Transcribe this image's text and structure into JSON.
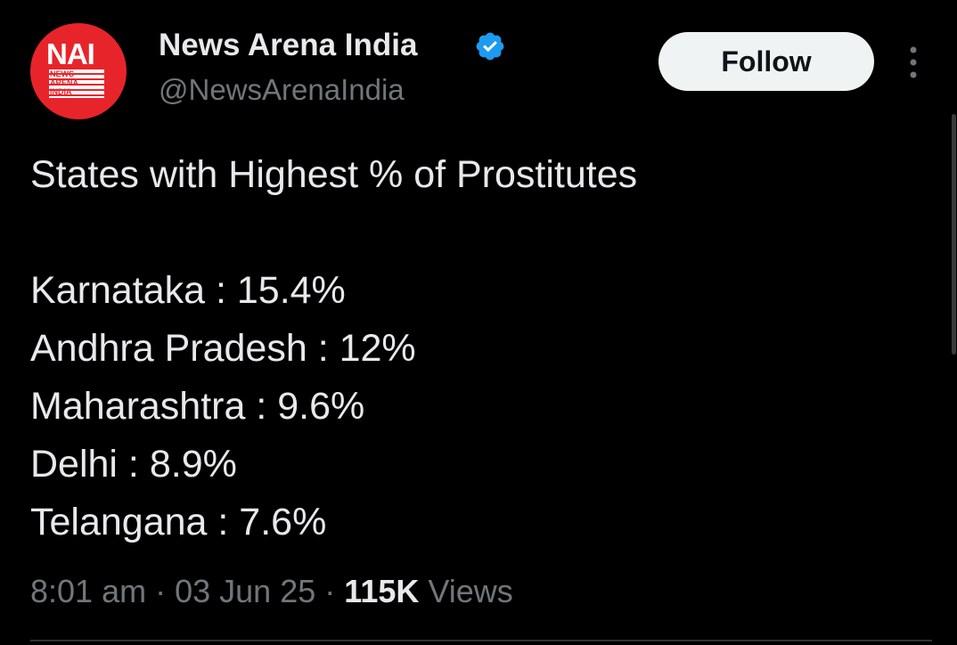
{
  "colors": {
    "background": "#000000",
    "text_primary": "#e7e9ea",
    "text_secondary": "#71767b",
    "brand_red": "#e8242b",
    "verified_blue": "#1d9bf0",
    "follow_bg": "#eff3f4",
    "follow_text": "#0f1419"
  },
  "author": {
    "avatar_logo": "NAI",
    "avatar_logo_sub": "NEWS\nARENA\nINDIA",
    "display_name": "News Arena India",
    "verified_icon": "verified-badge-icon",
    "handle": "@NewsArenaIndia"
  },
  "actions": {
    "follow_label": "Follow",
    "more_icon": "more-vertical-icon"
  },
  "tweet": {
    "headline": "States with Highest % of Prostitutes",
    "lines": [
      "Karnataka : 15.4%",
      "Andhra Pradesh : 12%",
      "Maharashtra : 9.6%",
      "Delhi : 8.9%",
      "Telangana : 7.6%"
    ]
  },
  "meta": {
    "time": "8:01 am",
    "separator": "·",
    "date": "03 Jun 25",
    "views_count": "115K",
    "views_label": "Views"
  }
}
